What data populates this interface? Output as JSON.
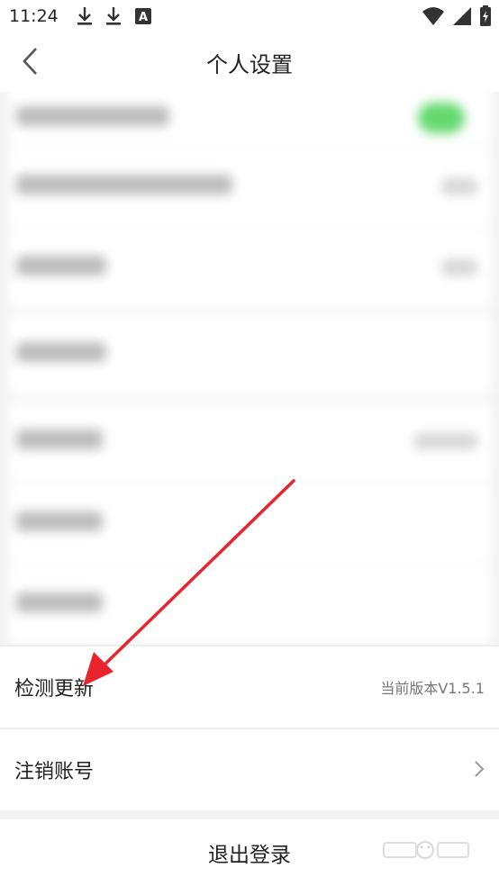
{
  "status_bar": {
    "time": "11:24",
    "left_icons": [
      "download-icon",
      "download-icon",
      "font-app-icon"
    ],
    "right_icons": [
      "wifi-icon",
      "signal-icon",
      "battery-charging-icon"
    ]
  },
  "header": {
    "title": "个人设置",
    "back_icon": "chevron-left-icon"
  },
  "rows": {
    "check_update": {
      "label": "检测更新",
      "value": "当前版本V1.5.1"
    },
    "cancel_account": {
      "label": "注销账号",
      "chevron_icon": "chevron-right-icon"
    }
  },
  "logout": {
    "label": "退出登录"
  },
  "annotation": {
    "type": "arrow",
    "color": "#e8242c"
  },
  "colors": {
    "toggle_on": "#64d96e",
    "annotation_red": "#e8242c",
    "background_gray": "#f3f3f3"
  }
}
